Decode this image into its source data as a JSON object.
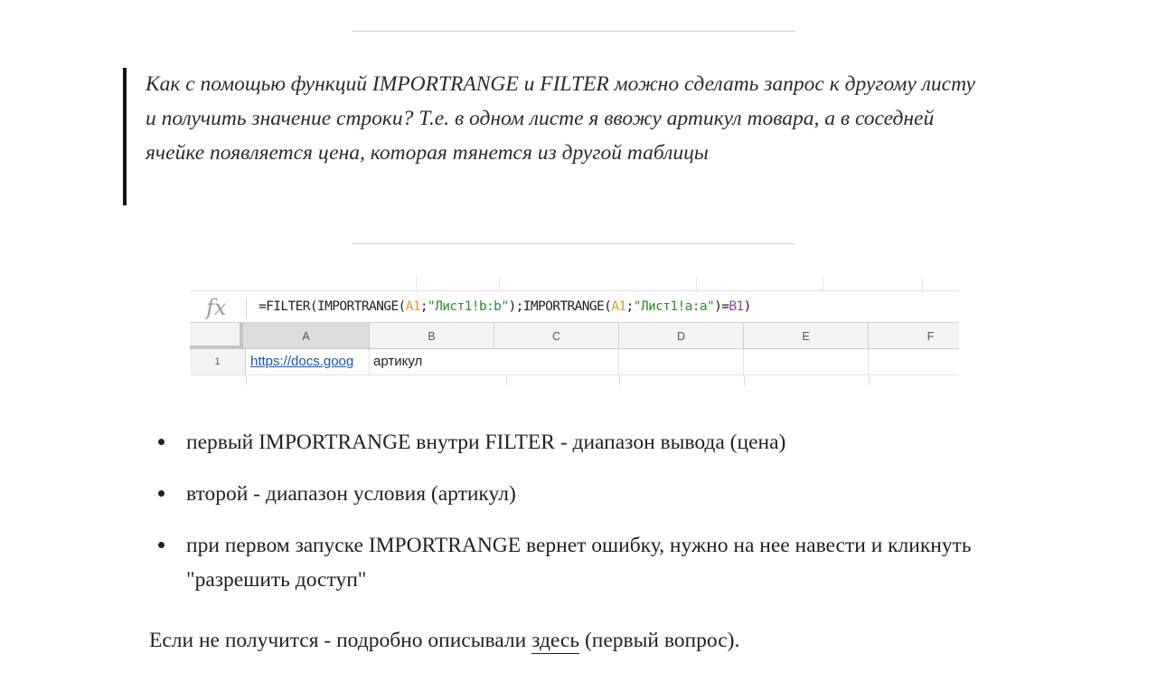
{
  "quote": {
    "text": "Как с помощью функций IMPORTRANGE и FILTER можно сделать запрос к другому листу и получить значение строки? Т.е. в одном листе я ввожу артикул товара, а в соседней ячейке появляется цена, которая тянется из другой таблицы"
  },
  "sheet": {
    "fx_label": "fx",
    "formula": {
      "p1": "=FILTER(IMPORTRANGE(",
      "ref1": "A1",
      "p2": ";",
      "str1": "\"Лист1!b:b\"",
      "p3": ");IMPORTRANGE(",
      "ref2": "A1",
      "p4": ";",
      "str2": "\"Лист1!a:a\"",
      "p5": ")=",
      "ref3": "B1",
      "p6": ")"
    },
    "columns": [
      "A",
      "B",
      "C",
      "D",
      "E",
      "F"
    ],
    "row_number": "1",
    "cell_a1": "https://docs.goog",
    "cell_b1": "артикул",
    "colors": {
      "ref": "#e69b2a",
      "string": "#2e8a2e",
      "ref_b": "#8e44ad",
      "link": "#1155cc"
    }
  },
  "bullets": [
    "первый IMPORTRANGE внутри FILTER - диапазон вывода (цена)",
    "второй - диапазон условия (артикул)",
    "при первом запуске IMPORTRANGE вернет ошибку, нужно на нее навести и кликнуть \"разрешить доступ\""
  ],
  "closing": {
    "before": "Если не получится - подробно описывали ",
    "link": "здесь",
    "after": " (первый вопрос)."
  }
}
